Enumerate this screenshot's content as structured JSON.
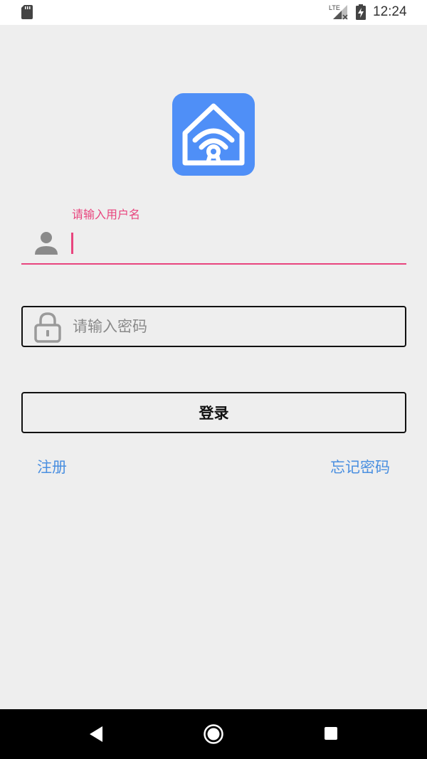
{
  "status_bar": {
    "network": "LTE",
    "time": "12:24"
  },
  "login": {
    "username_label": "请输入用户名",
    "username_value": "",
    "password_placeholder": "请输入密码",
    "login_label": "登录",
    "register_label": "注册",
    "forgot_label": "忘记密码"
  },
  "icons": {
    "sd_card": "sd-card-icon",
    "signal": "signal-icon",
    "battery": "battery-charging-icon",
    "logo": "smart-home-wifi-icon",
    "user": "user-icon",
    "lock": "lock-icon",
    "back": "back-icon",
    "home": "home-icon",
    "recent": "recent-apps-icon"
  },
  "colors": {
    "accent": "#e8457e",
    "link": "#4a8fe0",
    "logo_bg": "#4f8ff7",
    "background": "#eeeeee"
  }
}
